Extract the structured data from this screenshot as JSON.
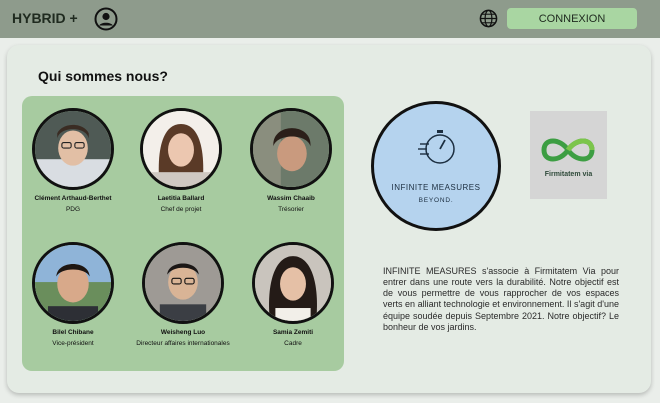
{
  "header": {
    "brand": "HYBRID +",
    "login_label": "CONNEXION"
  },
  "main": {
    "title": "Qui sommes nous?",
    "members": [
      {
        "name": "Clément Arthaud-Berthet",
        "role": "PDG"
      },
      {
        "name": "Laetitia Ballard",
        "role": "Chef de projet"
      },
      {
        "name": "Wassim Chaaib",
        "role": "Trésorier"
      },
      {
        "name": "Bilel Chibane",
        "role": "Vice-président"
      },
      {
        "name": "Weisheng Luo",
        "role": "Directeur affaires internationales"
      },
      {
        "name": "Samia Zemiti",
        "role": "Cadre"
      }
    ],
    "partner_logo_main": {
      "title": "INFINITE MEASURES",
      "subtitle": "BEYOND."
    },
    "partner_logo_secondary": {
      "title": "Firmitatem via"
    },
    "description": "INFINITE MEASURES s'associe à Firmitatem Via pour entrer dans une route vers la durabilité. Notre objectif est de vous permettre de vous rapprocher de vos espaces verts en alliant technologie et environnement. Il s'agit d'une équipe soudée depuis Septembre 2021. Notre objectif? Le bonheur de vos jardins."
  },
  "colors": {
    "topbar": "#8e9b8c",
    "login_button": "#a9d6a2",
    "team_panel": "#a7cba0",
    "logo_circle": "#b5d3ee"
  }
}
